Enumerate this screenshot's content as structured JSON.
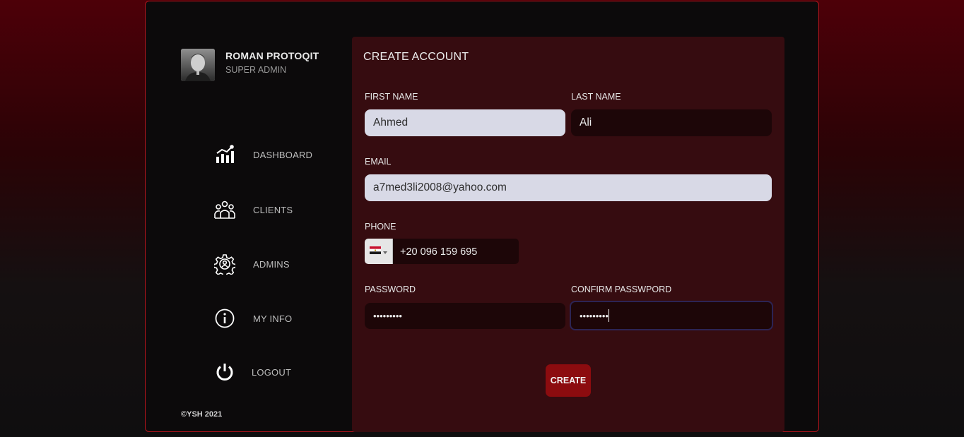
{
  "user": {
    "name": "ROMAN PROTOQIT",
    "role": "SUPER ADMIN"
  },
  "nav": [
    {
      "label": "DASHBOARD",
      "icon": "chart-bars-icon"
    },
    {
      "label": "CLIENTS",
      "icon": "users-group-icon"
    },
    {
      "label": "ADMINS",
      "icon": "gear-user-icon"
    },
    {
      "label": "MY INFO",
      "icon": "info-circle-icon"
    },
    {
      "label": "LOGOUT",
      "icon": "power-icon"
    }
  ],
  "footer": "©YSH 2021",
  "form": {
    "title": "CREATE ACCOUNT",
    "first_name_label": "FIRST NAME",
    "first_name_value": "Ahmed",
    "last_name_label": "LAST NAME",
    "last_name_value": "Ali",
    "email_label": "EMAIL",
    "email_value": "a7med3li2008@yahoo.com",
    "phone_label": "PHONE",
    "phone_value": "+20 096 159 695",
    "phone_country": "Egypt",
    "password_label": "PASSWORD",
    "password_value": "•••••••••",
    "confirm_label": "CONFIRM PASSWPORD",
    "confirm_value": "•••••••••",
    "create_label": "CREATE"
  },
  "colors": {
    "accent": "#8c0c0f",
    "frame_border": "#b3141c",
    "panel_bg": "#360c10",
    "sidebar_bg": "#0c0a0b"
  }
}
